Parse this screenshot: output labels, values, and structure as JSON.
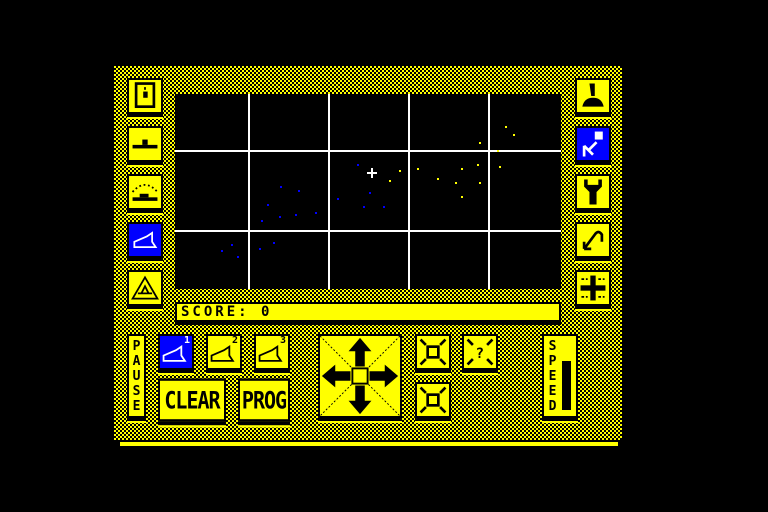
{
  "score": {
    "label": "SCORE:",
    "value": "0"
  },
  "left_toolbar": [
    {
      "icon": "bomb-icon"
    },
    {
      "icon": "submarine-icon"
    },
    {
      "icon": "ship-gauge-icon"
    },
    {
      "icon": "ship-select-icon",
      "selected": true
    },
    {
      "icon": "rocks-icon"
    }
  ],
  "right_toolbar": [
    {
      "icon": "joystick-icon"
    },
    {
      "icon": "pointer-icon",
      "selected": true
    },
    {
      "icon": "wrench-icon"
    },
    {
      "icon": "hook-icon"
    },
    {
      "icon": "grid-icon"
    }
  ],
  "ships": [
    {
      "number": "1",
      "selected": true
    },
    {
      "number": "2"
    },
    {
      "number": "3"
    }
  ],
  "buttons": {
    "pause": "PAUSE",
    "clear": "CLEAR",
    "prog": "PROG",
    "speed": "SPEED"
  },
  "speed_level": 0.7,
  "colors": {
    "yellow": "#ffff00",
    "blue": "#0000ff",
    "black": "#000000",
    "white": "#ffffff"
  }
}
